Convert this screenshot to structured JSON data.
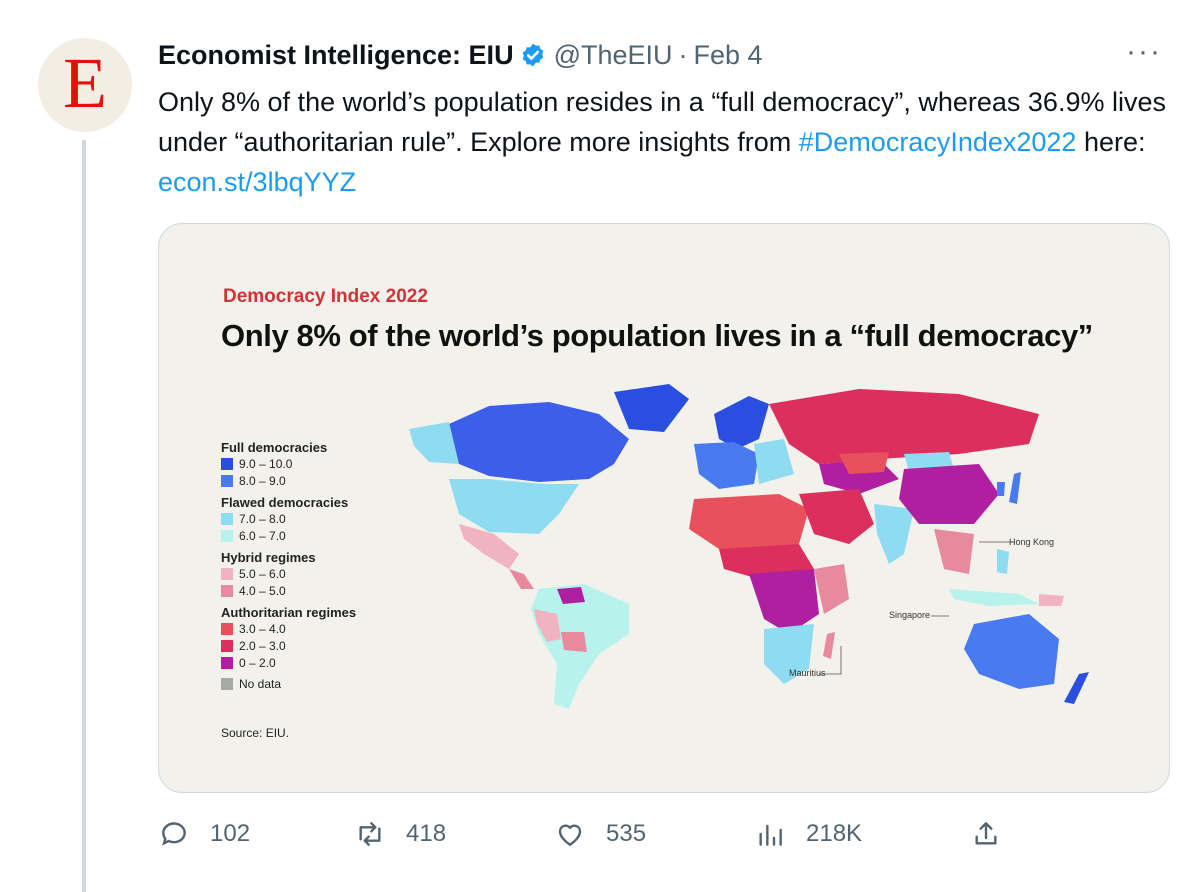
{
  "tweet": {
    "author_name": "Economist Intelligence: EIU",
    "handle": "@TheEIU",
    "separator": "·",
    "date": "Feb 4",
    "avatar_letter": "E",
    "more_label": "···",
    "text_main": "Only 8% of the world’s population resides in a “full democracy”, whereas 36.9% lives under “authoritarian rule”. Explore more insights from ",
    "hashtag": "#DemocracyIndex2022",
    "text_mid": " here: ",
    "link": "econ.st/3lbqYYZ"
  },
  "image": {
    "eyebrow": "Democracy Index 2022",
    "headline": "Only 8% of the world’s population lives in a “full democracy”",
    "source": "Source: EIU.",
    "legend": [
      {
        "group": "Full democracies",
        "items": [
          {
            "label": "9.0 – 10.0",
            "color": "#2a4fe0"
          },
          {
            "label": "8.0 – 9.0",
            "color": "#4a7af0"
          }
        ]
      },
      {
        "group": "Flawed democracies",
        "items": [
          {
            "label": "7.0 – 8.0",
            "color": "#8fdcf2"
          },
          {
            "label": "6.0 – 7.0",
            "color": "#b8f2ec"
          }
        ]
      },
      {
        "group": "Hybrid regimes",
        "items": [
          {
            "label": "5.0 – 6.0",
            "color": "#f2b3c0"
          },
          {
            "label": "4.0 – 5.0",
            "color": "#e88a9e"
          }
        ]
      },
      {
        "group": "Authoritarian regimes",
        "items": [
          {
            "label": "3.0 – 4.0",
            "color": "#e8505b"
          },
          {
            "label": "2.0 – 3.0",
            "color": "#dc2f5e"
          },
          {
            "label": "0 – 2.0",
            "color": "#b01fa0"
          }
        ]
      },
      {
        "group": "",
        "items": [
          {
            "label": "No data",
            "color": "#a8aaa8"
          }
        ]
      }
    ],
    "annotations": {
      "hong_kong": "Hong Kong",
      "singapore": "Singapore",
      "mauritius": "Mauritius"
    }
  },
  "actions": {
    "replies": "102",
    "retweets": "418",
    "likes": "535",
    "views": "218K"
  },
  "colors": {
    "link": "#1d9bf0",
    "muted": "#536471",
    "eyebrow": "#d13438"
  }
}
